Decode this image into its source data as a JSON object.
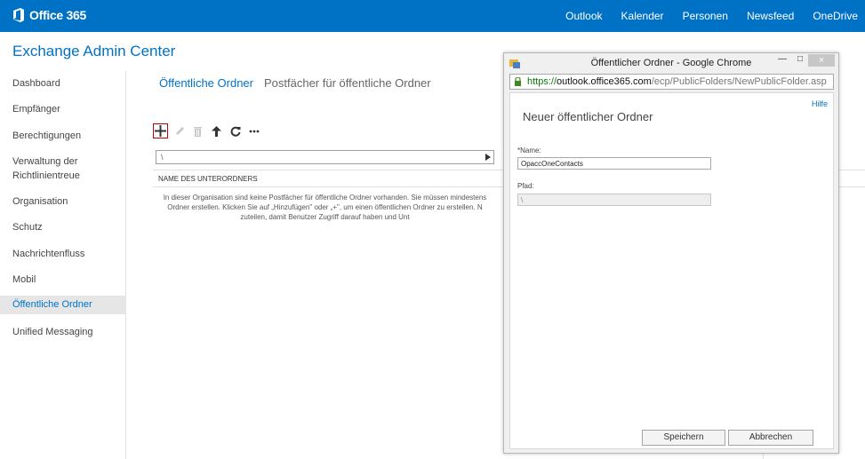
{
  "topbar": {
    "brand": "Office 365",
    "nav": [
      "Outlook",
      "Kalender",
      "Personen",
      "Newsfeed",
      "OneDrive"
    ],
    "brand_color": "#0072c6"
  },
  "app_title": "Exchange Admin Center",
  "sidebar": {
    "items": [
      {
        "label": "Dashboard"
      },
      {
        "label": "Empfänger"
      },
      {
        "label": "Berechtigungen"
      },
      {
        "label": "Verwaltung der Richtlinientreue"
      },
      {
        "label": "Organisation"
      },
      {
        "label": "Schutz"
      },
      {
        "label": "Nachrichtenfluss"
      },
      {
        "label": "Mobil"
      },
      {
        "label": "Öffentliche Ordner",
        "active": true
      },
      {
        "label": "Unified Messaging"
      }
    ]
  },
  "main": {
    "tabs": [
      {
        "label": "Öffentliche Ordner",
        "active": true
      },
      {
        "label": "Postfächer für öffentliche Ordner",
        "active": false
      }
    ],
    "toolbar": [
      "add-icon",
      "edit-icon",
      "delete-icon",
      "up-arrow-icon",
      "refresh-icon",
      "more-icon"
    ],
    "path_value": "\\",
    "column_header": "NAME DES UNTERORDNERS",
    "empty_message": [
      "In dieser Organisation sind keine Postfächer für öffentliche Ordner vorhanden. Sie müssen mindestens",
      "Ordner erstellen. Klicken Sie auf „Hinzufügen\" oder „+\", um einen öffentlichen Ordner zu erstellen. N",
      "zuteilen, damit Benutzer Zugriff darauf haben und Unt"
    ]
  },
  "popup": {
    "window_title": "Öffentlicher Ordner - Google Chrome",
    "url": {
      "https": "https://",
      "host": "outlook.office365.com",
      "path": "/ecp/PublicFolders/NewPublicFolder.asp"
    },
    "help": "Hilfe",
    "dialog_title": "Neuer öffentlicher Ordner",
    "name_label": "*Name:",
    "name_value": "OpaccOneContacts",
    "path_label": "Pfad:",
    "path_value": "\\",
    "save_button": "Speichern",
    "cancel_button": "Abbrechen",
    "close_glyph": "×"
  }
}
